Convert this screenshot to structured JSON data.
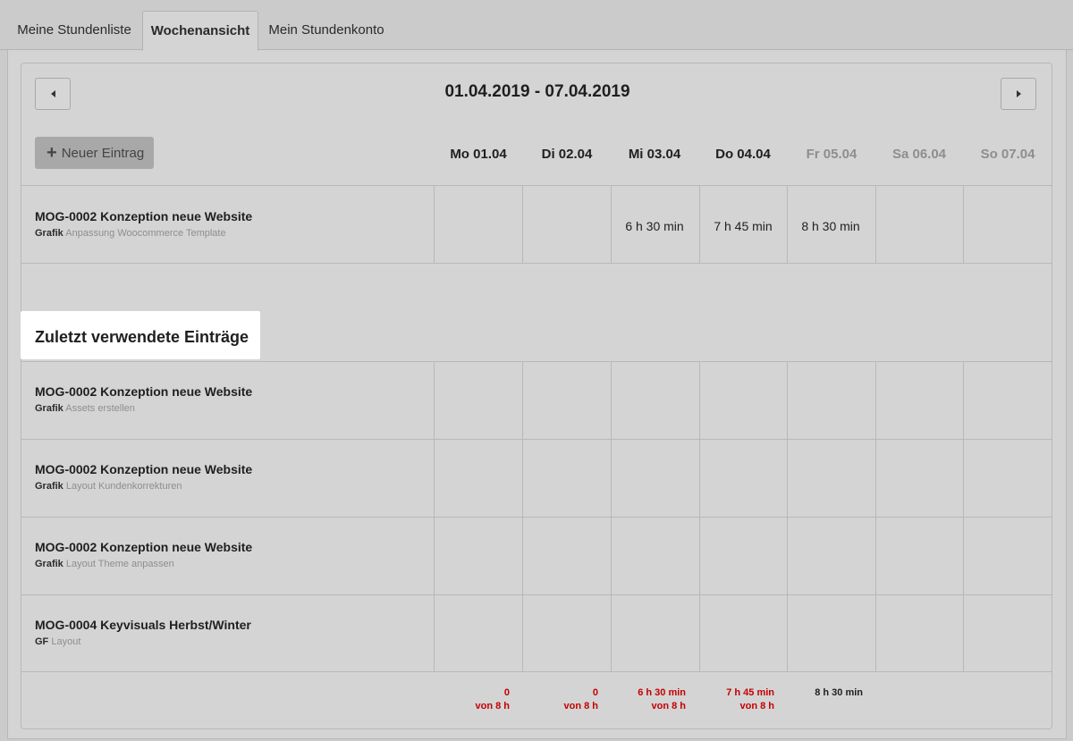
{
  "tabs": [
    {
      "label": "Meine Stundenliste",
      "active": false
    },
    {
      "label": "Wochenansicht",
      "active": true
    },
    {
      "label": "Mein Stundenkonto",
      "active": false
    }
  ],
  "week": {
    "range": "01.04.2019 - 07.04.2019",
    "new_entry_label": "Neuer Eintrag",
    "days": [
      {
        "label": "Mo 01.04",
        "muted": false
      },
      {
        "label": "Di 02.04",
        "muted": false
      },
      {
        "label": "Mi 03.04",
        "muted": false
      },
      {
        "label": "Do 04.04",
        "muted": false
      },
      {
        "label": "Fr 05.04",
        "muted": true
      },
      {
        "label": "Sa 06.04",
        "muted": true
      },
      {
        "label": "So 07.04",
        "muted": true
      }
    ]
  },
  "current_entry": {
    "title": "MOG-0002 Konzeption neue Website",
    "category": "Grafik",
    "task": "Anpassung Woocommerce Template",
    "values": [
      "",
      "",
      "6 h 30 min",
      "7 h 45 min",
      "8 h 30 min",
      "",
      ""
    ]
  },
  "recent": {
    "heading": "Zuletzt verwendete Einträge",
    "entries": [
      {
        "title": "MOG-0002 Konzeption neue Website",
        "category": "Grafik",
        "task": "Assets erstellen"
      },
      {
        "title": "MOG-0002 Konzeption neue Website",
        "category": "Grafik",
        "task": "Layout Kundenkorrekturen"
      },
      {
        "title": "MOG-0002 Konzeption neue Website",
        "category": "Grafik",
        "task": "Layout Theme anpassen"
      },
      {
        "title": "MOG-0004 Keyvisuals Herbst/Winter",
        "category": "GF",
        "task": "Layout"
      }
    ]
  },
  "totals": [
    {
      "line1": "0",
      "line2": "von 8 h",
      "status": "under"
    },
    {
      "line1": "0",
      "line2": "von 8 h",
      "status": "under"
    },
    {
      "line1": "6 h 30 min",
      "line2": "von 8 h",
      "status": "under"
    },
    {
      "line1": "7 h 45 min",
      "line2": "von 8 h",
      "status": "under"
    },
    {
      "line1": "8 h 30 min",
      "line2": "",
      "status": "ok"
    }
  ],
  "colors": {
    "under_target": "#c40000",
    "background": "#cbcbcb",
    "panel": "#d4d4d4",
    "highlight": "#ffffff"
  }
}
